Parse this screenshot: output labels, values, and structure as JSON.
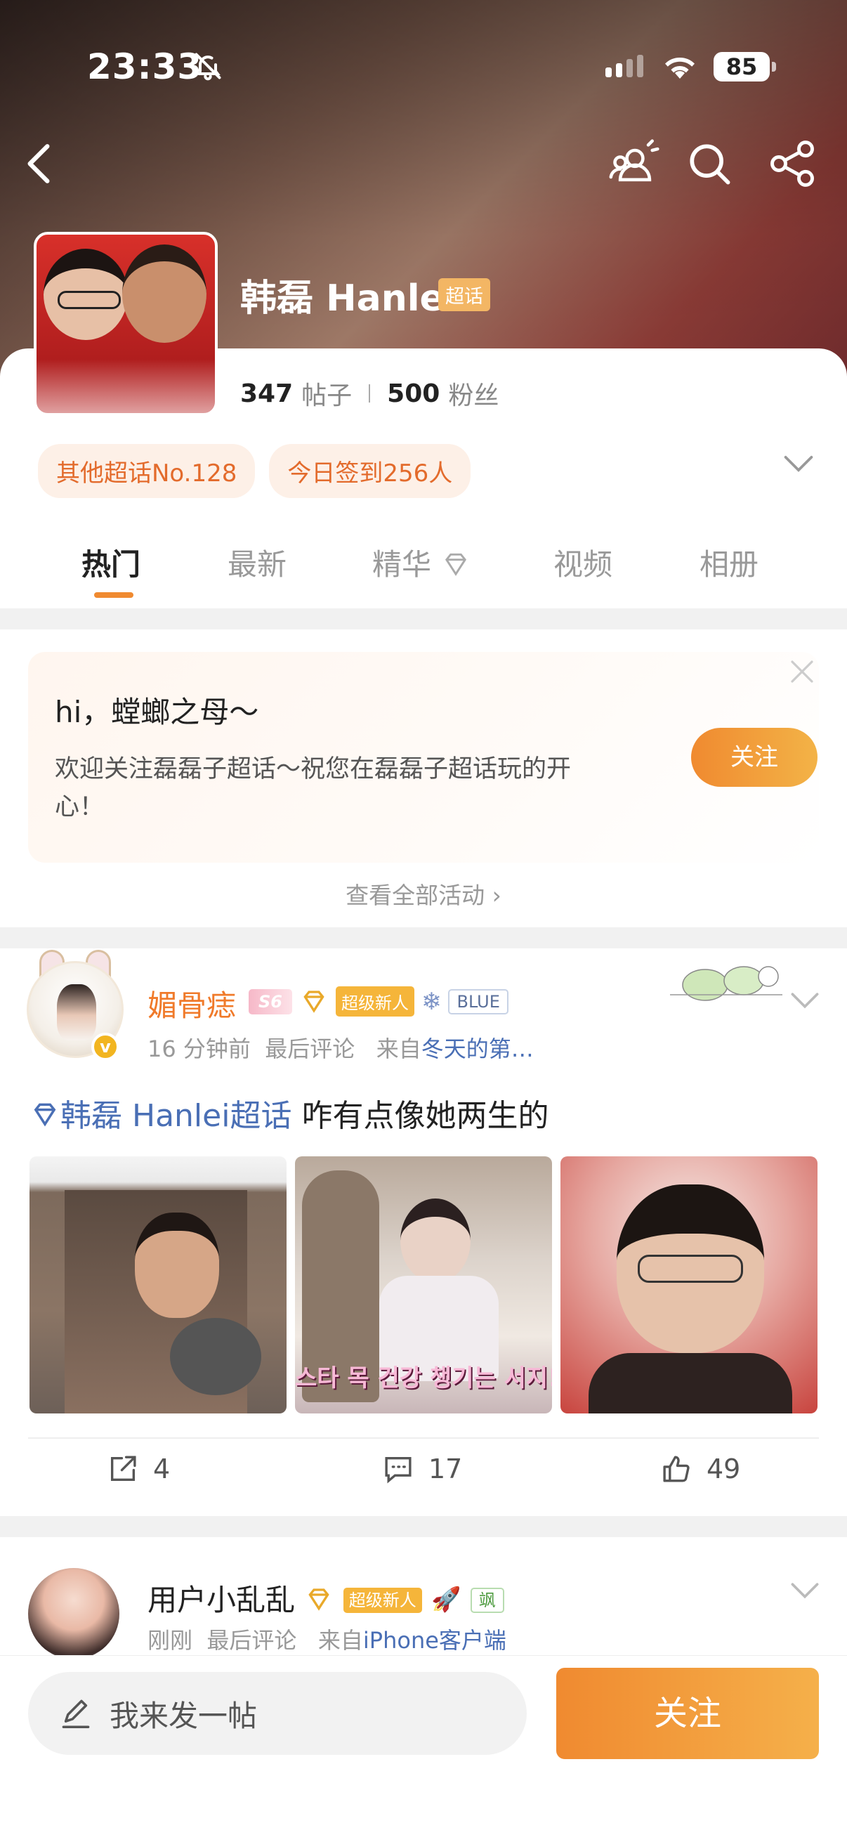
{
  "status_bar": {
    "time": "23:33",
    "battery": "85"
  },
  "group": {
    "name": "韩磊 Hanlei",
    "tag": "超话",
    "posts_count": "347",
    "posts_label": "帖子",
    "fans_count": "500",
    "fans_label": "粉丝",
    "chips": [
      "其他超话No.128",
      "今日签到256人"
    ]
  },
  "tabs": [
    "热门",
    "最新",
    "精华",
    "视频",
    "相册"
  ],
  "welcome": {
    "greeting": "hi，螳螂之母～",
    "message": "欢迎关注磊磊子超话～祝您在磊磊子超话玩的开心！",
    "follow_label": "关注",
    "see_all": "查看全部活动 ›"
  },
  "post1": {
    "author": "媚骨痣",
    "level_badge": "S6",
    "newbie_badge": "超级新人",
    "blue_badge": "BLUE",
    "time": "16 分钟前",
    "last_comment": "最后评论",
    "from_label": "来自",
    "source": "冬天的第…",
    "topic": "韩磊 Hanlei超话",
    "text": " 咋有点像她两生的",
    "image2_caption": "스타 목 건강 챙기는 서지!",
    "shares": "4",
    "comments": "17",
    "likes": "49"
  },
  "post2": {
    "author": "用户小乱乱",
    "newbie_badge": "超级新人",
    "green_badge": "飒",
    "time": "刚刚",
    "last_comment": "最后评论",
    "from_label": "来自",
    "source": "iPhone客户端"
  },
  "bottom": {
    "compose_placeholder": "我来发一帖",
    "follow_label": "关注"
  },
  "colors": {
    "accent": "#f08a30",
    "link": "#4a6fb5",
    "author": "#f07a2a"
  }
}
